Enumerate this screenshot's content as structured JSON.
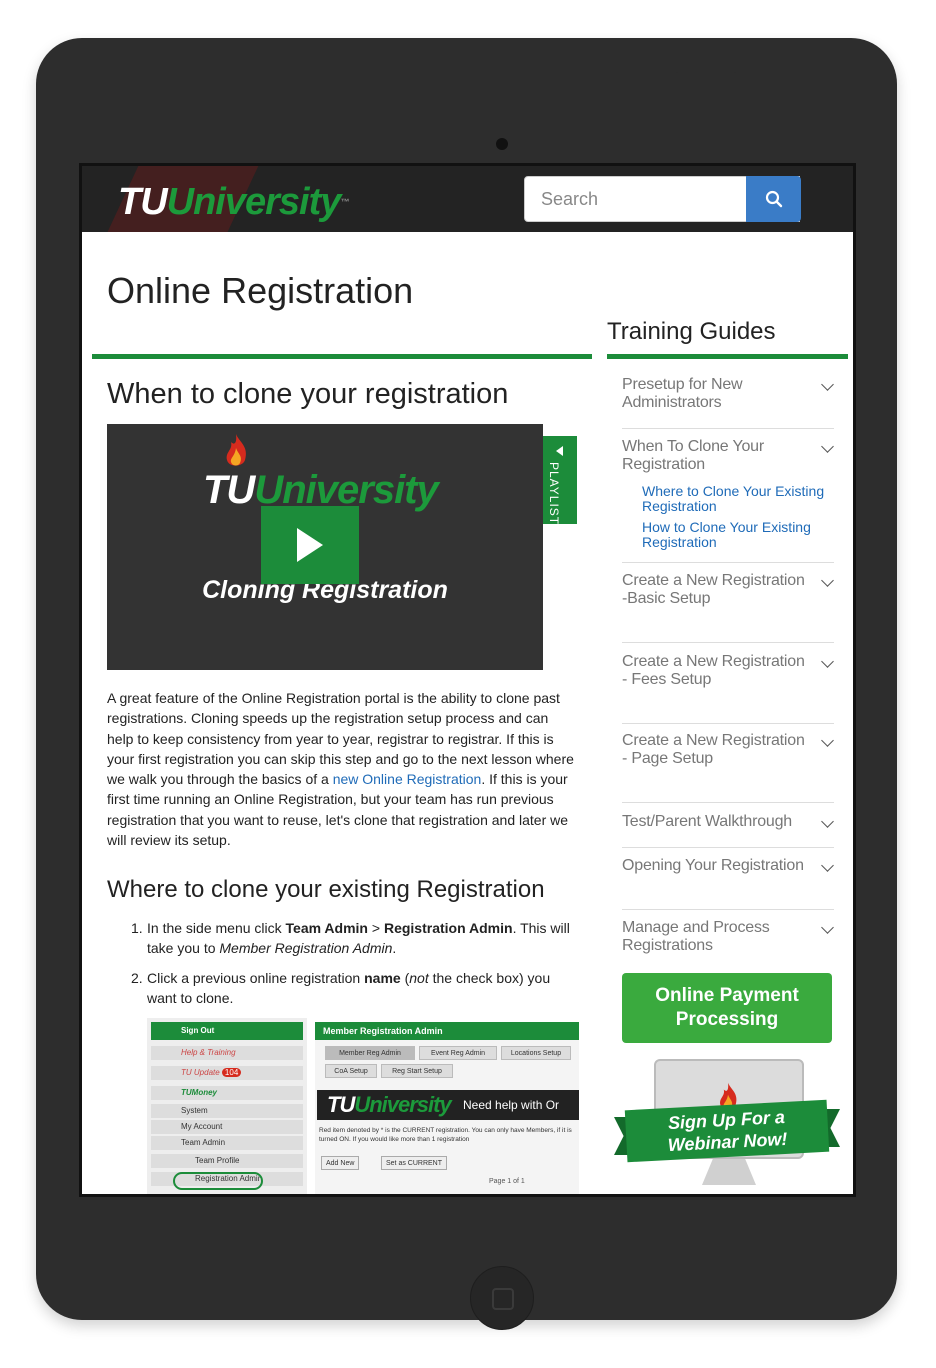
{
  "header": {
    "logo_tu": "TU",
    "logo_university": "University",
    "logo_tm": "™",
    "search_placeholder": "Search"
  },
  "page_title": "Online Registration",
  "sidebar": {
    "title": "Training Guides",
    "items": [
      {
        "label": "Presetup for New Administrators"
      },
      {
        "label": "When To Clone Your Registration",
        "sub_links": [
          "Where to Clone Your Existing Registration",
          "How to Clone Your Existing Registration"
        ]
      },
      {
        "label": "Create a New Registration -Basic Setup"
      },
      {
        "label": "Create a New Registration - Fees Setup"
      },
      {
        "label": "Create a New Registration - Page Setup"
      },
      {
        "label": "Test/Parent Walkthrough"
      },
      {
        "label": "Opening Your Registration"
      },
      {
        "label": "Manage and Process Registrations"
      }
    ],
    "payment_button": "Online Payment Processing",
    "webinar_banner": "Sign Up For a Webinar Now!"
  },
  "main": {
    "section1_title": "When to clone your registration",
    "video": {
      "logo_tu": "TU",
      "logo_university": "University",
      "caption": "Cloning Registration",
      "playlist_label": "PLAYLIST"
    },
    "paragraph": {
      "before_link": "A great feature of the Online Registration portal is the ability to clone past registrations. Cloning speeds up the registration setup process and can help to keep consistency from year to year, registrar to registrar. If this is your first registration you can skip this step and go to the next lesson where we walk you through the basics of a ",
      "link": "new Online Registration",
      "after_link": ". If this is your first time running an Online Registration, but your team has run previous registration that you want to reuse, let's clone that registration and later we will review its setup."
    },
    "section2_title": "Where to clone your existing Registration",
    "steps": [
      {
        "num": "1.",
        "t1": "In the side menu click ",
        "b1": "Team Admin",
        "t2": " > ",
        "b2": "Registration Admin",
        "t3": ". This will take you to ",
        "i1": "Member Registration Admin",
        "t4": "."
      },
      {
        "num": "2.",
        "t1": "Click a previous online registration ",
        "b1": "name",
        "t2": " (",
        "i1": "not",
        "t3": " the check box) you want to clone."
      }
    ],
    "screenshot": {
      "left_menu": [
        "Sign Out",
        "Help & Training",
        "TU Update",
        "TUMoney",
        "System",
        "My Account",
        "Team Admin",
        "Team Profile",
        "Registration Admin"
      ],
      "update_badge": "104",
      "panel_title": "Member Registration Admin",
      "tabs": [
        "Member Reg Admin",
        "Event Reg Admin",
        "Locations Setup",
        "CoA Setup",
        "Reg Start Setup"
      ],
      "banner_logo_tu": "TU",
      "banner_logo_university": "University",
      "banner_text": "Need help with Or",
      "note": "Red item denoted by * is the CURRENT registration. You can only have Members, if it is turned ON. If you would like more than 1 registration",
      "buttons": [
        "Add New",
        "Set as CURRENT"
      ],
      "pager": "Page 1 of 1"
    }
  },
  "colors": {
    "brand_green": "#1c8c3a",
    "link_blue": "#1f6bb8",
    "search_blue": "#3a7cc7",
    "header_dark": "#232323",
    "device_frame": "#2d2d2d"
  }
}
